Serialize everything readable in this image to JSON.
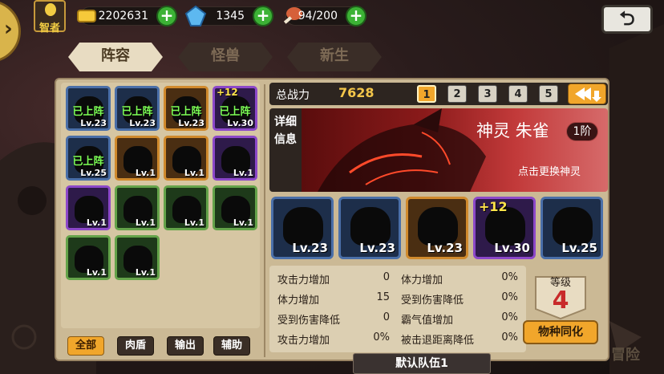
{
  "top": {
    "rank": "智者",
    "gold": "2202631",
    "gems": "1345",
    "stamina": "94/200",
    "plus": "+",
    "back": "⮌"
  },
  "tabs": [
    "阵容",
    "怪兽",
    "新生"
  ],
  "roster": [
    {
      "lv": "Lv.23",
      "deployed": "已上阵",
      "color": "blue"
    },
    {
      "lv": "Lv.23",
      "deployed": "已上阵",
      "color": "blue"
    },
    {
      "lv": "Lv.23",
      "deployed": "已上阵",
      "color": "orange"
    },
    {
      "lv": "Lv.30",
      "deployed": "已上阵",
      "plus": "+12",
      "color": "purple"
    },
    {
      "lv": "Lv.25",
      "deployed": "已上阵",
      "color": "blue"
    },
    {
      "lv": "Lv.1",
      "color": "orange"
    },
    {
      "lv": "Lv.1",
      "color": "orange"
    },
    {
      "lv": "Lv.1",
      "color": "purple"
    },
    {
      "lv": "Lv.1",
      "color": "purple"
    },
    {
      "lv": "Lv.1",
      "color": "green"
    },
    {
      "lv": "Lv.1",
      "color": "green"
    },
    {
      "lv": "Lv.1",
      "color": "green"
    },
    {
      "lv": "Lv.1",
      "color": "green"
    },
    {
      "lv": "Lv.1",
      "color": "green"
    }
  ],
  "filters": [
    "全部",
    "肉盾",
    "输出",
    "辅助"
  ],
  "power": {
    "label": "总战力",
    "value": "7628"
  },
  "teams": [
    "1",
    "2",
    "3",
    "4",
    "5"
  ],
  "detail": {
    "tag": "详细信息",
    "god_name": "神灵 朱雀",
    "tier": "1阶",
    "hint": "点击更换神灵"
  },
  "team_cards": [
    {
      "lv": "Lv.23",
      "color": "blue"
    },
    {
      "lv": "Lv.23",
      "color": "blue"
    },
    {
      "lv": "Lv.23",
      "color": "orange"
    },
    {
      "lv": "Lv.30",
      "plus": "+12",
      "color": "purple"
    },
    {
      "lv": "Lv.25",
      "color": "blue"
    }
  ],
  "stats": [
    {
      "name": "攻击力增加",
      "value": "0"
    },
    {
      "name": "体力增加",
      "value": "0%"
    },
    {
      "name": "体力增加",
      "value": "15"
    },
    {
      "name": "受到伤害降低",
      "value": "0%"
    },
    {
      "name": "受到伤害降低",
      "value": "0"
    },
    {
      "name": "霸气值增加",
      "value": "0%"
    },
    {
      "name": "攻击力增加",
      "value": "0%"
    },
    {
      "name": "被击退距离降低",
      "value": "0%"
    }
  ],
  "level": {
    "label": "等级",
    "value": "4"
  },
  "sync": "物种同化",
  "team_name": "默认队伍1",
  "adventure": "冒险",
  "colors": {
    "accent": "#f1a62b",
    "panel": "#cbb995"
  }
}
